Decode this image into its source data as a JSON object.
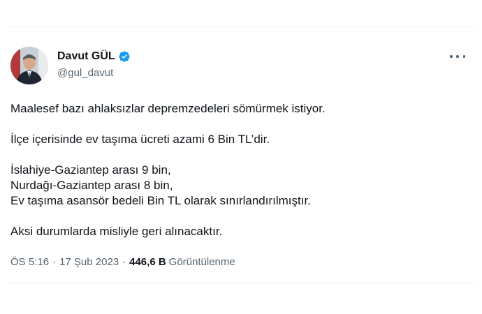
{
  "author": {
    "display_name": "Davut GÜL",
    "handle": "@gul_davut",
    "verified": true,
    "verified_color": "#1d9bf0"
  },
  "menu": {
    "icon": "more-horizontal-icon"
  },
  "tweet": {
    "paragraph_1": "Maalesef bazı ahlaksızlar depremzedeleri sömürmek istiyor.",
    "paragraph_2": "İlçe içerisinde ev taşıma ücreti azami 6 Bin TL’dir.",
    "paragraph_3_line_1": "İslahiye-Gaziantep arası 9 bin,",
    "paragraph_3_line_2": "Nurdağı-Gaziantep arası 8 bin,",
    "paragraph_3_line_3": "Ev taşıma asansör bedeli Bin TL olarak sınırlandırılmıştır.",
    "paragraph_4": "Aksi durumlarda misliyle geri alınacaktır."
  },
  "meta": {
    "time": "ÖS 5:16",
    "separator": "·",
    "date": "17 Şub 2023",
    "views_count": "446,6 B",
    "views_label": "Görüntülenme"
  },
  "colors": {
    "text_primary": "#0f1419",
    "text_secondary": "#536471",
    "border": "#eff3f4"
  }
}
